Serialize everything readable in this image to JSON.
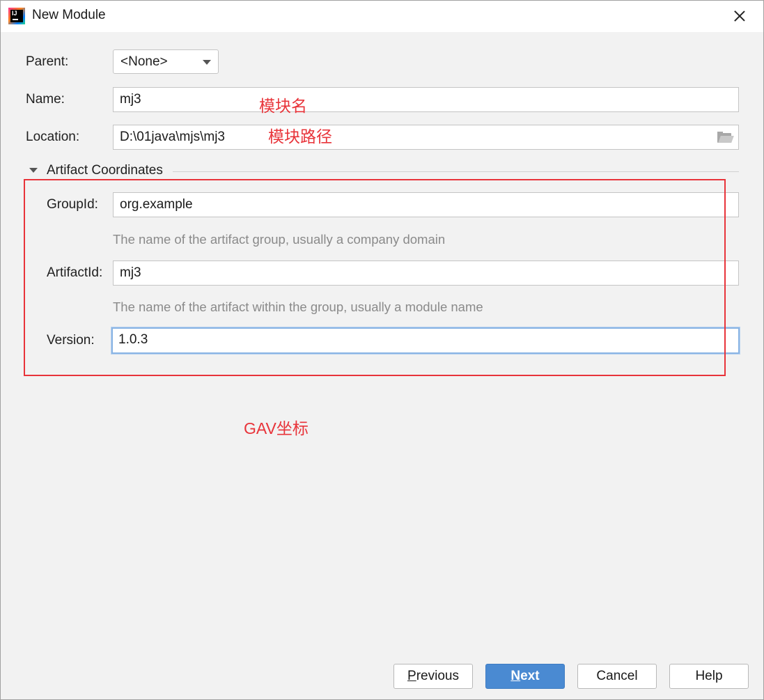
{
  "window": {
    "title": "New Module",
    "icon": "intellij-idea-icon",
    "icon_letters": "IJ"
  },
  "form": {
    "parent": {
      "label": "Parent:",
      "value": "<None>"
    },
    "name": {
      "label": "Name:",
      "value": "mj3"
    },
    "location": {
      "label": "Location:",
      "value": "D:\\01java\\mjs\\mj3"
    }
  },
  "artifact": {
    "section_title": "Artifact Coordinates",
    "group_id": {
      "label": "GroupId:",
      "value": "org.example",
      "hint": "The name of the artifact group, usually a company domain"
    },
    "artifact_id": {
      "label": "ArtifactId:",
      "value": "mj3",
      "hint": "The name of the artifact within the group, usually a module name"
    },
    "version": {
      "label": "Version:",
      "value": "1.0.3"
    }
  },
  "annotations": {
    "module_name": "模块名",
    "module_path": "模块路径",
    "gav": "GAV坐标",
    "color": "#e8343a"
  },
  "buttons": {
    "previous": {
      "mnemonic": "P",
      "rest": "revious"
    },
    "next": {
      "mnemonic": "N",
      "rest": "ext"
    },
    "cancel": "Cancel",
    "help": "Help"
  },
  "colors": {
    "primary_button": "#4a8ad2",
    "focus_ring": "#8ab4e4",
    "background": "#f2f2f2"
  }
}
